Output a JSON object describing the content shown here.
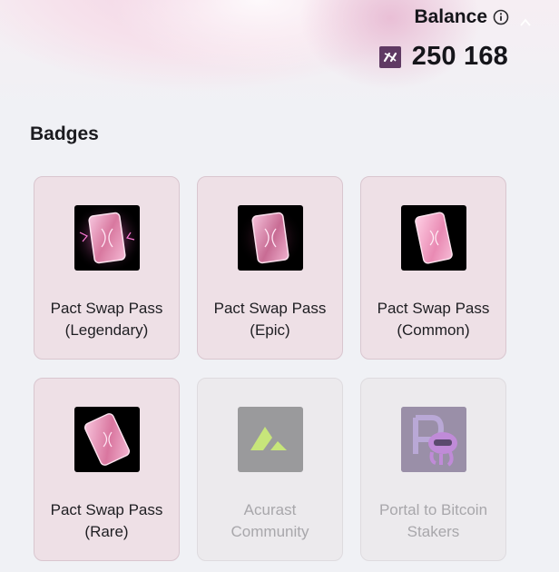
{
  "balance": {
    "label": "Balance",
    "value": "250 168",
    "info_icon": "info-icon",
    "token_icon": "token-icon"
  },
  "badges": {
    "title": "Badges",
    "items": [
      {
        "line1": "Pact Swap Pass",
        "line2": "(Legendary)",
        "locked": false,
        "icon": "legendary-pass-icon"
      },
      {
        "line1": "Pact Swap Pass",
        "line2": "(Epic)",
        "locked": false,
        "icon": "epic-pass-icon"
      },
      {
        "line1": "Pact Swap Pass",
        "line2": "(Common)",
        "locked": false,
        "icon": "common-pass-icon"
      },
      {
        "line1": "Pact Swap Pass",
        "line2": "(Rare)",
        "locked": false,
        "icon": "rare-pass-icon"
      },
      {
        "line1": "Acurast",
        "line2": "Community",
        "locked": true,
        "icon": "acurast-logo-icon"
      },
      {
        "line1": "Portal to Bitcoin",
        "line2": "Stakers",
        "locked": true,
        "icon": "portal-bitcoin-icon"
      }
    ]
  },
  "colors": {
    "card_bg": "#eee0e6",
    "card_locked_bg": "#eceaed",
    "token_bg": "#5f3a63",
    "acurast_green": "#c7e57a",
    "pass_pink": "#f2a9cf"
  }
}
